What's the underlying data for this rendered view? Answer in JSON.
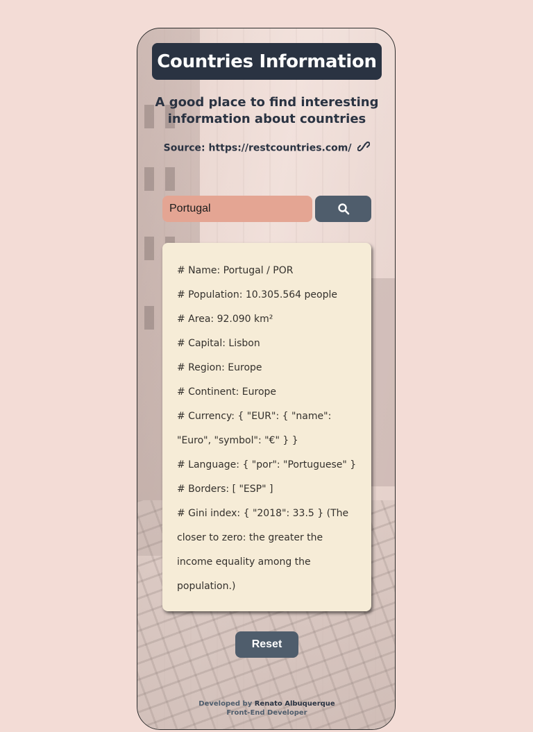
{
  "header": {
    "title": "Countries Information",
    "subtitle": "A good place to find interesting information about countries",
    "source_label": "Source: https://restcountries.com/"
  },
  "search": {
    "value": "Portugal",
    "placeholder": "",
    "button_icon": "search-icon"
  },
  "info": {
    "lines": [
      "# Name: Portugal / POR",
      "# Population: 10.305.564 people",
      "# Area: 92.090 km²",
      "# Capital: Lisbon",
      "# Region: Europe",
      "# Continent: Europe",
      "# Currency: { \"EUR\": { \"name\":",
      "\"Euro\", \"symbol\": \"€\" } }",
      "# Language: { \"por\": \"Portuguese\" }",
      "# Borders: [ \"ESP\" ]",
      "# Gini index: { \"2018\": 33.5 } (The",
      "closer to zero: the greater the",
      "income equality among the",
      "population.)"
    ]
  },
  "reset": {
    "label": "Reset"
  },
  "footer": {
    "developed_by": "Developed by",
    "author": "Renato Albuquerque",
    "role": "Front-End Developer"
  },
  "colors": {
    "page_bg": "#f3dcd6",
    "title_bg": "#2a3342",
    "input_bg": "#e4a593",
    "button_bg": "#4f5d6c",
    "card_bg": "#f6ecd7"
  }
}
